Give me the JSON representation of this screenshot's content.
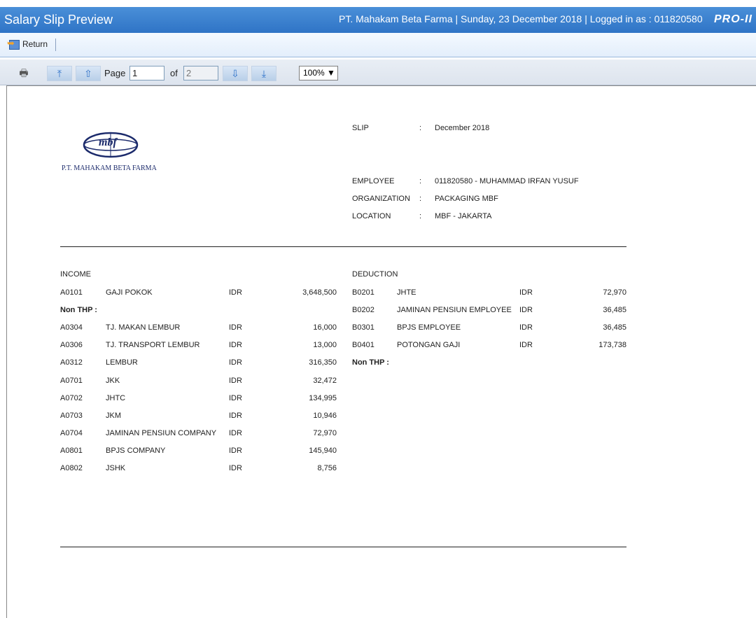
{
  "header": {
    "app_title": "Salary Slip Preview",
    "info": "PT. Mahakam Beta Farma | Sunday, 23 December 2018 | Logged in as : 011820580",
    "logo_text": "PRO-II"
  },
  "toolbar": {
    "return_label": "Return"
  },
  "pager": {
    "page_label": "Page",
    "page_value": "1",
    "of_label": "of",
    "total_pages": "2",
    "zoom": "100% ▼"
  },
  "icons": {
    "print": "printer-icon",
    "first": "first-page-icon",
    "prev": "previous-page-icon",
    "next": "next-page-icon",
    "last": "last-page-icon"
  },
  "slip": {
    "company_logo_text": "mbf",
    "company_name": "P.T. MAHAKAM BETA FARMA",
    "fields": [
      {
        "label": "SLIP",
        "sep": ":",
        "value": "December 2018"
      },
      {
        "label": "EMPLOYEE",
        "sep": ":",
        "value": "011820580 - MUHAMMAD IRFAN YUSUF"
      },
      {
        "label": "ORGANIZATION",
        "sep": ":",
        "value": "PACKAGING MBF"
      },
      {
        "label": "LOCATION",
        "sep": ":",
        "value": "MBF - JAKARTA"
      }
    ],
    "income_title": "INCOME",
    "deduction_title": "DEDUCTION",
    "income": [
      {
        "code": "A0101",
        "name": "GAJI POKOK",
        "cur": "IDR",
        "amount": "3,648,500"
      },
      {
        "code": "Non THP :",
        "name": "",
        "cur": "",
        "amount": "",
        "bold": true
      },
      {
        "code": "A0304",
        "name": "TJ. MAKAN LEMBUR",
        "cur": "IDR",
        "amount": "16,000"
      },
      {
        "code": "A0306",
        "name": "TJ. TRANSPORT LEMBUR",
        "cur": "IDR",
        "amount": "13,000"
      },
      {
        "code": "A0312",
        "name": "LEMBUR",
        "cur": "IDR",
        "amount": "316,350"
      },
      {
        "code": "A0701",
        "name": "JKK",
        "cur": "IDR",
        "amount": "32,472"
      },
      {
        "code": "A0702",
        "name": "JHTC",
        "cur": "IDR",
        "amount": "134,995"
      },
      {
        "code": "A0703",
        "name": "JKM",
        "cur": "IDR",
        "amount": "10,946"
      },
      {
        "code": "A0704",
        "name": "JAMINAN PENSIUN COMPANY",
        "cur": "IDR",
        "amount": "72,970"
      },
      {
        "code": "A0801",
        "name": "BPJS COMPANY",
        "cur": "IDR",
        "amount": "145,940"
      },
      {
        "code": "A0802",
        "name": "JSHK",
        "cur": "IDR",
        "amount": "8,756"
      }
    ],
    "deduction": [
      {
        "code": "B0201",
        "name": "JHTE",
        "cur": "IDR",
        "amount": "72,970"
      },
      {
        "code": "B0202",
        "name": "JAMINAN PENSIUN EMPLOYEE",
        "cur": "IDR",
        "amount": "36,485"
      },
      {
        "code": "B0301",
        "name": "BPJS EMPLOYEE",
        "cur": "IDR",
        "amount": "36,485"
      },
      {
        "code": "B0401",
        "name": "POTONGAN GAJI",
        "cur": "IDR",
        "amount": "173,738"
      },
      {
        "code": "Non THP :",
        "name": "",
        "cur": "",
        "amount": "",
        "bold": true
      }
    ]
  }
}
